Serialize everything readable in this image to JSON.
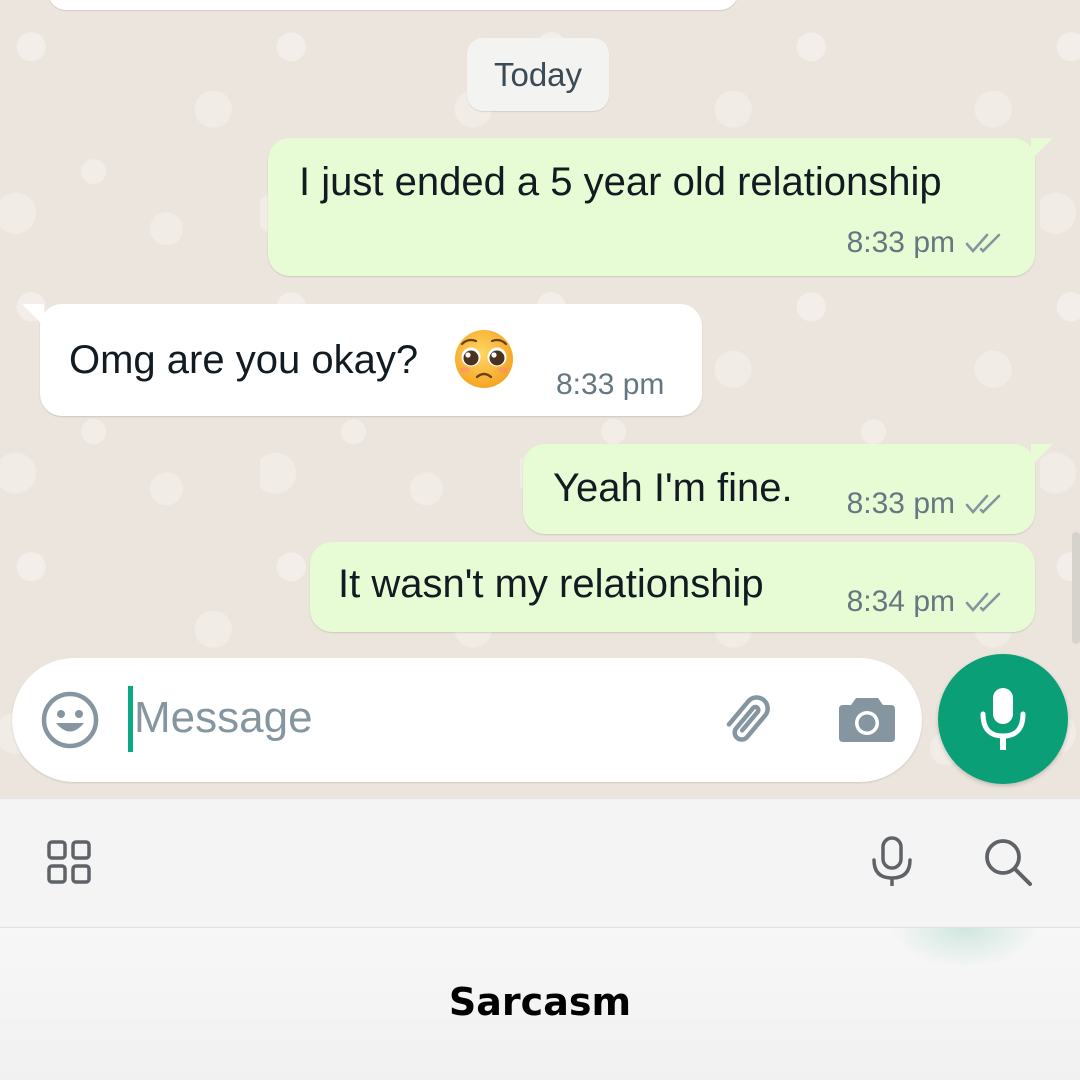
{
  "date_separator": "Today",
  "messages": [
    {
      "direction": "outgoing",
      "text": "I just ended a 5 year old relationship",
      "time": "8:33 pm",
      "status": "read-double-check"
    },
    {
      "direction": "incoming",
      "text": "Omg are you okay?",
      "emoji": "pleading-face",
      "time": "8:33 pm"
    },
    {
      "direction": "outgoing",
      "text": "Yeah I'm fine.",
      "time": "8:33 pm",
      "status": "read-double-check"
    },
    {
      "direction": "outgoing",
      "text": "It wasn't my relationship",
      "time": "8:34 pm",
      "status": "read-double-check"
    }
  ],
  "composer": {
    "placeholder": "Message",
    "icons": [
      "emoji-icon",
      "attachment-icon",
      "camera-icon"
    ],
    "send_button_icon": "mic-icon"
  },
  "keyboard_toolbar": {
    "icons": [
      "apps-grid-icon",
      "voice-input-icon",
      "search-icon"
    ]
  },
  "caption": "Sarcasm",
  "colors": {
    "chat_background": "#ece5dd",
    "outgoing_bubble": "#e7fcd4",
    "incoming_bubble": "#ffffff",
    "accent_green": "#0a9f76",
    "cursor": "#0aa884",
    "timestamp_gray": "#667781",
    "tick_gray": "#8696a0"
  }
}
